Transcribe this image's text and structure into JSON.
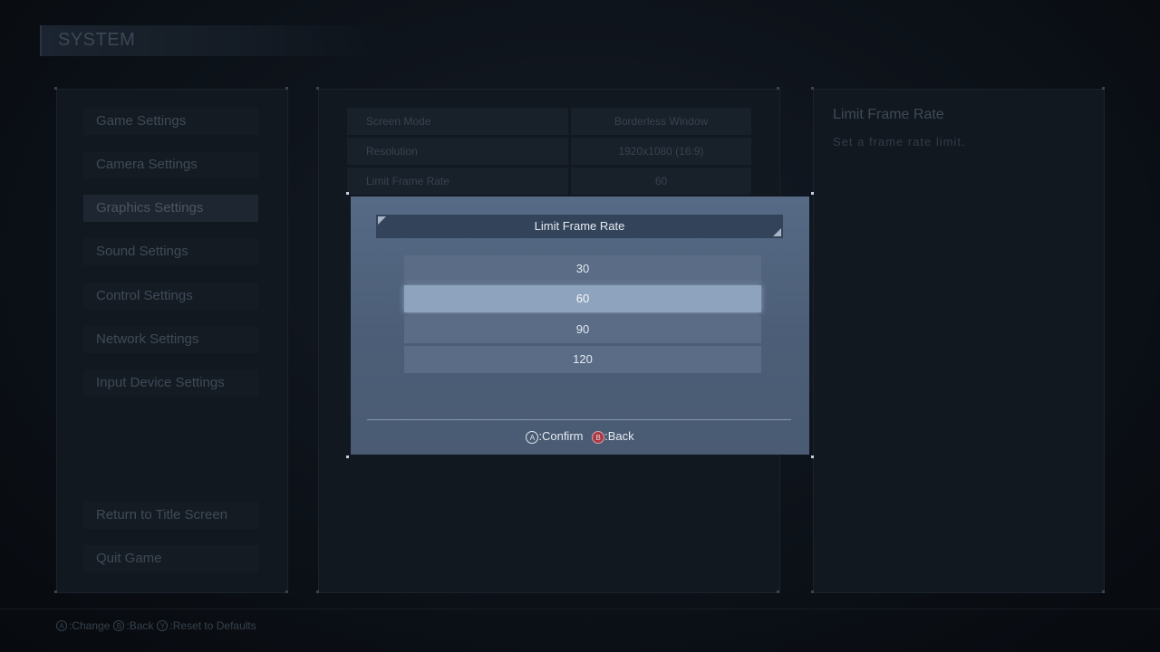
{
  "header": {
    "title": "SYSTEM"
  },
  "menu": {
    "items": [
      {
        "label": "Game Settings"
      },
      {
        "label": "Camera Settings"
      },
      {
        "label": "Graphics Settings",
        "active": true
      },
      {
        "label": "Sound Settings"
      },
      {
        "label": "Control Settings"
      },
      {
        "label": "Network Settings"
      },
      {
        "label": "Input Device Settings"
      }
    ],
    "bottom": [
      {
        "label": "Return to Title Screen"
      },
      {
        "label": "Quit Game"
      }
    ]
  },
  "settings": {
    "rows": [
      {
        "label": "Screen Mode",
        "value": "Borderless Window"
      },
      {
        "label": "Resolution",
        "value": "1920x1080 (16:9)"
      },
      {
        "label": "Limit Frame Rate",
        "value": "60"
      }
    ]
  },
  "info": {
    "title": "Limit Frame Rate",
    "description": "Set a frame rate limit."
  },
  "footer": {
    "change_key": "A",
    "change_label": ":Change",
    "back_key": "B",
    "back_label": ":Back",
    "reset_key": "Y",
    "reset_label": ":Reset to Defaults"
  },
  "dialog": {
    "title": "Limit Frame Rate",
    "options": [
      "30",
      "60",
      "90",
      "120"
    ],
    "selected_index": 1,
    "confirm_key": "A",
    "confirm_label": ":Confirm",
    "back_key": "B",
    "back_label": ":Back"
  },
  "colors": {
    "background": "#0b0f15",
    "dialog": "#4c5e77",
    "selected_option": "#8ea3be",
    "back_button": "#a83a45"
  }
}
